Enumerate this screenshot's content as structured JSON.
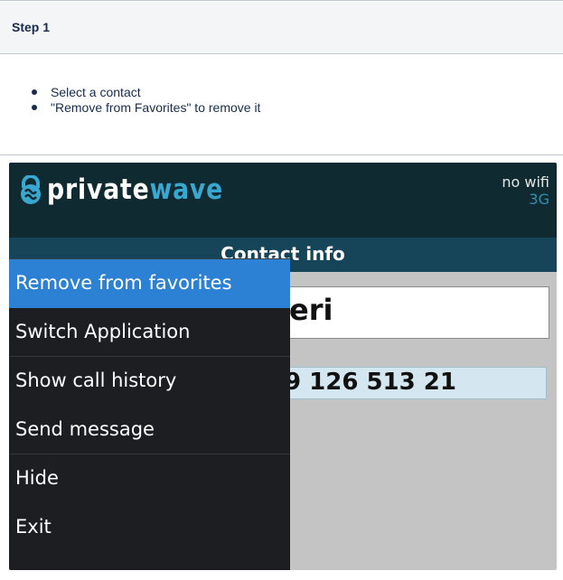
{
  "step": {
    "title": "Step 1",
    "instructions": [
      "Select a contact",
      "\"Remove from Favorites\" to remove it"
    ]
  },
  "app": {
    "logo": {
      "private": "private",
      "wave": "wave"
    },
    "network": {
      "wifi": "no wifi",
      "cellular": "3G"
    },
    "screen_title": "Contact info",
    "contact": {
      "name_visible": "eri",
      "phone_visible": "9 126 513 21"
    },
    "menu": {
      "selected_index": 0,
      "items": [
        "Remove from favorites",
        "Switch Application",
        "Show call history",
        "Send message",
        "Hide",
        "Exit"
      ]
    }
  },
  "colors": {
    "header_bg": "#0f2a30",
    "title_bar_bg": "#16455a",
    "menu_bg": "#1c1e21",
    "menu_selected": "#2c81d4",
    "accent": "#39a8d0"
  },
  "icons": {
    "logo": "privatewave-logo-icon"
  }
}
